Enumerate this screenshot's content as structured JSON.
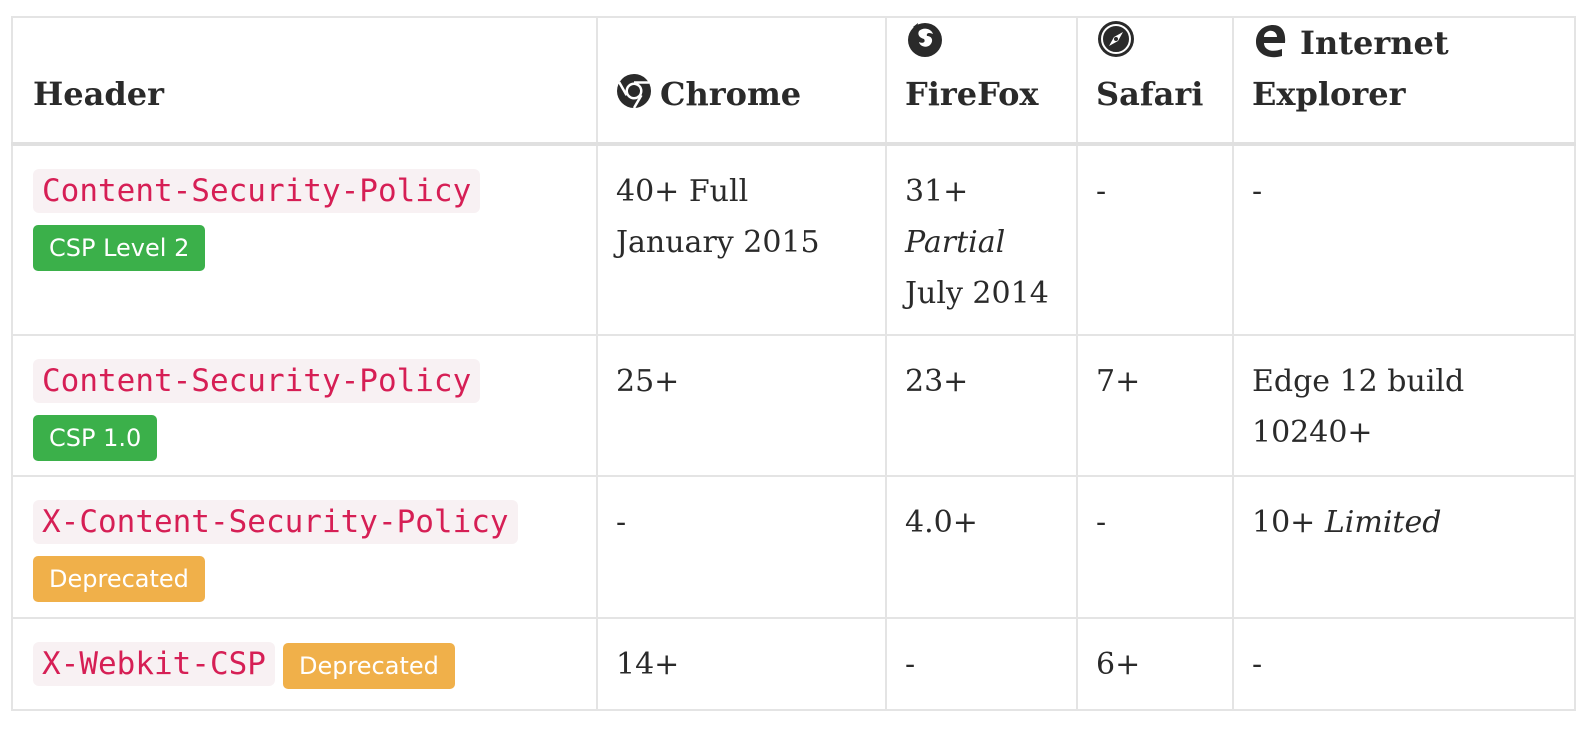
{
  "table": {
    "columns": {
      "header": "Header",
      "chrome": "Chrome",
      "firefox": "FireFox",
      "safari": "Safari",
      "ie_line1": "Internet",
      "ie_line2": "Explorer"
    },
    "icons": {
      "chrome": "chrome-icon",
      "firefox": "firefox-icon",
      "safari": "safari-icon",
      "ie": "edge-icon"
    },
    "colors": {
      "code_text": "#d61f55",
      "code_bg": "#f8f1f3",
      "badge_green": "#3bb04a",
      "badge_orange": "#f0b04a"
    },
    "rows": [
      {
        "header": "Content-Security-Policy",
        "badge": "CSP Level 2",
        "chrome_line1": "40+ Full",
        "chrome_line2": "January 2015",
        "firefox_line1": "31+",
        "firefox_line2": "Partial",
        "firefox_line3": "July 2014",
        "safari": "-",
        "ie": "-"
      },
      {
        "header": "Content-Security-Policy",
        "badge": "CSP 1.0",
        "chrome": "25+",
        "firefox": "23+",
        "safari": "7+",
        "ie_line1": "Edge 12 build",
        "ie_line2": "10240+"
      },
      {
        "header": "X-Content-Security-Policy",
        "badge": "Deprecated",
        "chrome": "-",
        "firefox": "4.0+",
        "safari": "-",
        "ie_main": "10+",
        "ie_note": "Limited"
      },
      {
        "header": "X-Webkit-CSP",
        "badge": "Deprecated",
        "chrome": "14+",
        "firefox": "-",
        "safari": "6+",
        "ie": "-"
      }
    ]
  }
}
